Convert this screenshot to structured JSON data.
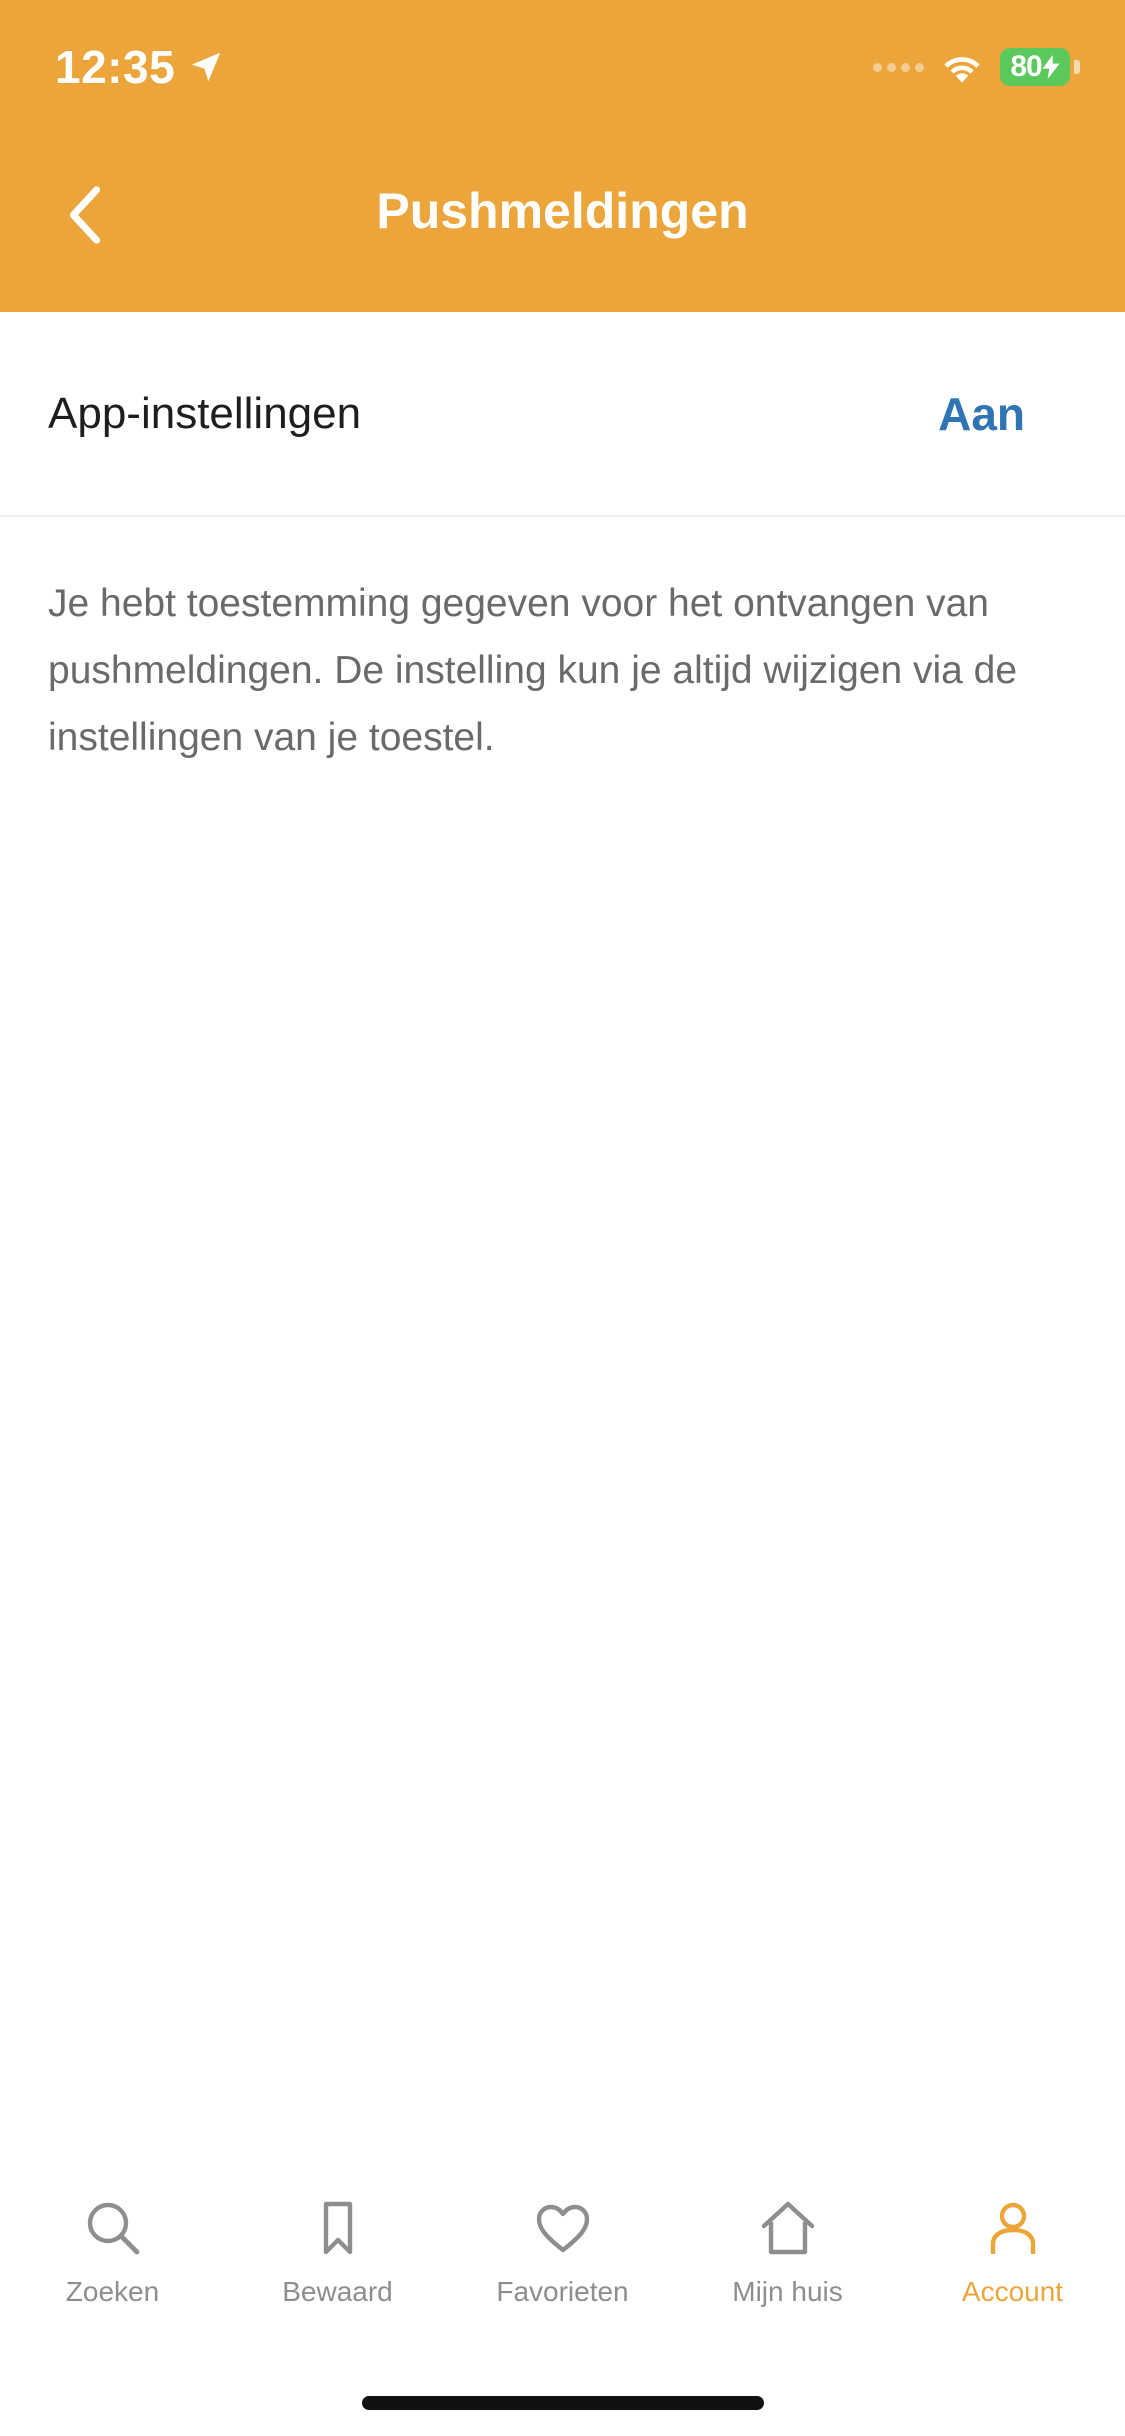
{
  "status_bar": {
    "time": "12:35",
    "battery": "80"
  },
  "nav": {
    "title": "Pushmeldingen"
  },
  "settings": {
    "label": "App-instellingen",
    "value": "Aan"
  },
  "description": "Je hebt toestemming gegeven voor het ontvangen van pushmeldingen. De instelling kun je altijd wijzigen via de instellingen van je toestel.",
  "tabs": [
    {
      "label": "Zoeken",
      "icon": "search-icon"
    },
    {
      "label": "Bewaard",
      "icon": "bookmark-icon"
    },
    {
      "label": "Favorieten",
      "icon": "heart-icon"
    },
    {
      "label": "Mijn huis",
      "icon": "home-icon"
    },
    {
      "label": "Account",
      "icon": "person-icon",
      "active": true
    }
  ],
  "colors": {
    "brand": "#EBA53A",
    "link": "#2F74B3",
    "battery": "#5BC85B"
  }
}
